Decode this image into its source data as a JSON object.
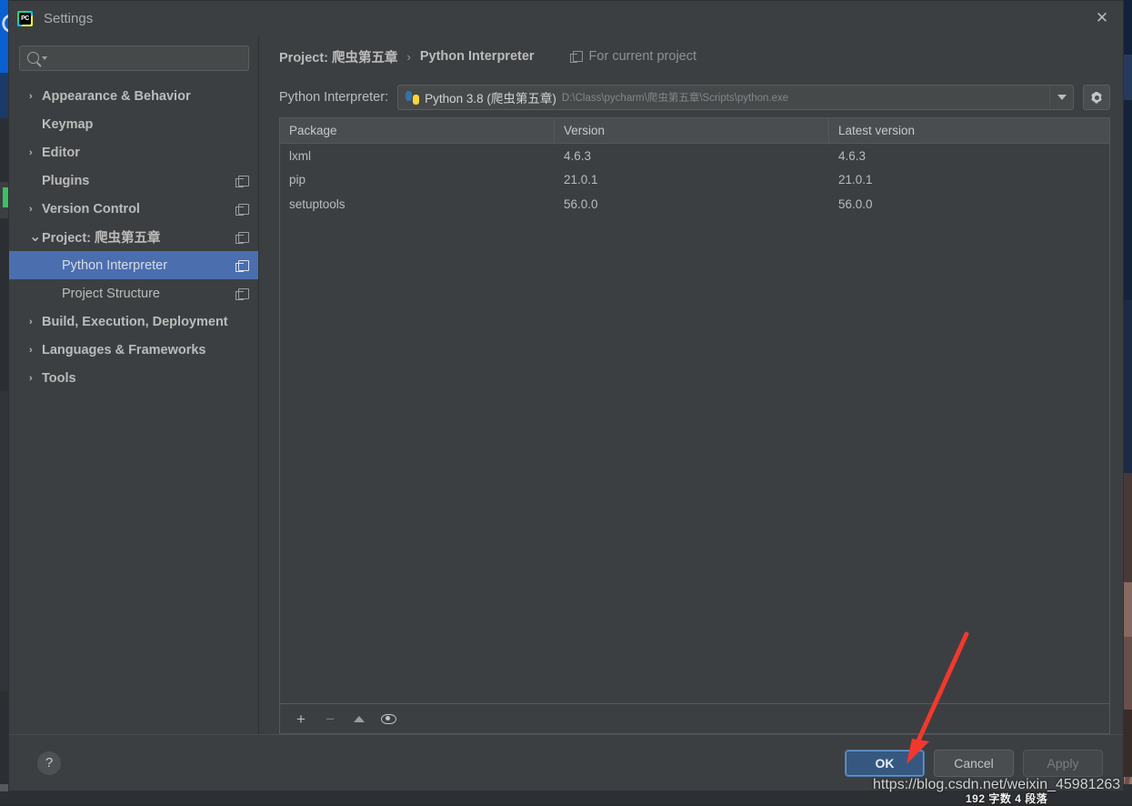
{
  "window": {
    "title": "Settings",
    "app_icon": "pycharm-icon",
    "close_icon": "close-icon"
  },
  "sidebar": {
    "search": {
      "value": "",
      "placeholder": "",
      "icon": "search-icon"
    },
    "items": [
      {
        "label": "Appearance & Behavior",
        "arrow": "›",
        "bold": true,
        "indent": false,
        "selected": false,
        "badge": false
      },
      {
        "label": "Keymap",
        "arrow": "",
        "bold": true,
        "indent": false,
        "selected": false,
        "badge": false
      },
      {
        "label": "Editor",
        "arrow": "›",
        "bold": true,
        "indent": false,
        "selected": false,
        "badge": false
      },
      {
        "label": "Plugins",
        "arrow": "",
        "bold": true,
        "indent": false,
        "selected": false,
        "badge": true
      },
      {
        "label": "Version Control",
        "arrow": "›",
        "bold": true,
        "indent": false,
        "selected": false,
        "badge": true
      },
      {
        "label": "Project: 爬虫第五章",
        "arrow": "⌄",
        "bold": true,
        "indent": false,
        "selected": false,
        "badge": true
      },
      {
        "label": "Python Interpreter",
        "arrow": "",
        "bold": false,
        "indent": true,
        "selected": true,
        "badge": true
      },
      {
        "label": "Project Structure",
        "arrow": "",
        "bold": false,
        "indent": true,
        "selected": false,
        "badge": true
      },
      {
        "label": "Build, Execution, Deployment",
        "arrow": "›",
        "bold": true,
        "indent": false,
        "selected": false,
        "badge": false
      },
      {
        "label": "Languages & Frameworks",
        "arrow": "›",
        "bold": true,
        "indent": false,
        "selected": false,
        "badge": false
      },
      {
        "label": "Tools",
        "arrow": "›",
        "bold": true,
        "indent": false,
        "selected": false,
        "badge": false
      }
    ]
  },
  "main": {
    "breadcrumb": {
      "root": "Project: 爬虫第五章",
      "separator": "›",
      "current": "Python Interpreter",
      "scope": "For current project",
      "scope_icon": "copy-scope-icon"
    },
    "interpreter": {
      "label": "Python Interpreter:",
      "name": "Python 3.8 (爬虫第五章)",
      "path": "D:\\Class\\pycharm\\爬虫第五章\\Scripts\\python.exe",
      "icon": "python-icon",
      "dropdown_icon": "chevron-down-icon",
      "settings_icon": "gear-icon"
    },
    "packages_table": {
      "columns": [
        "Package",
        "Version",
        "Latest version"
      ],
      "rows": [
        {
          "package": "lxml",
          "version": "4.6.3",
          "latest": "4.6.3"
        },
        {
          "package": "pip",
          "version": "21.0.1",
          "latest": "21.0.1"
        },
        {
          "package": "setuptools",
          "version": "56.0.0",
          "latest": "56.0.0"
        }
      ],
      "toolbar": [
        {
          "name": "add-package-button",
          "glyph": "+",
          "dim": false
        },
        {
          "name": "remove-package-button",
          "glyph": "−",
          "dim": true
        },
        {
          "name": "upgrade-package-button",
          "glyph": "triangle-up-icon",
          "dim": true
        },
        {
          "name": "show-early-releases-button",
          "glyph": "eye-icon",
          "dim": false
        }
      ]
    }
  },
  "footer": {
    "help_label": "?",
    "ok_label": "OK",
    "cancel_label": "Cancel",
    "apply_label": "Apply"
  },
  "annotations": {
    "watermark": "https://blog.csdn.net/weixin_45981263",
    "word_count": "192 字数  4 段落",
    "arrow_color": "#f2382e"
  },
  "colors": {
    "dialog_bg": "#3c3f41",
    "selection_blue": "#4b6eaf",
    "primary_button": "#365880",
    "text": "#bbbbbb"
  }
}
